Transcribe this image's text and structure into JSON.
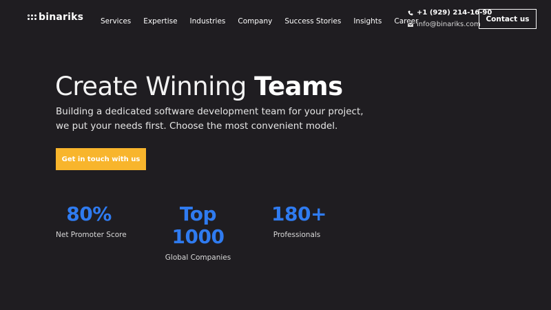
{
  "header": {
    "logo": {
      "text": "binariks"
    },
    "nav": [
      "Services",
      "Expertise",
      "Industries",
      "Company",
      "Success Stories",
      "Insights",
      "Career"
    ],
    "contact": {
      "phone": "+1 (929) 214-16-90",
      "email": "info@binariks.com",
      "button_label": "Contact us"
    }
  },
  "hero": {
    "title_light": "Create Winning ",
    "title_bold": "Teams",
    "subtitle": "Building a dedicated software development team for your project, we put your needs first. Choose the most convenient model.",
    "cta_label": "Get in touch with us"
  },
  "stats": [
    {
      "value": "80%",
      "label": "Net Promoter Score"
    },
    {
      "value": "Top 1000",
      "label": "Global Companies"
    },
    {
      "value": "180+",
      "label": "Professionals"
    }
  ],
  "colors": {
    "background": "#1f1d21",
    "accent_blue": "#2f7bf0",
    "cta_yellow": "#f8b52c"
  },
  "icons": {
    "phone": "phone-icon",
    "email": "email-icon"
  }
}
